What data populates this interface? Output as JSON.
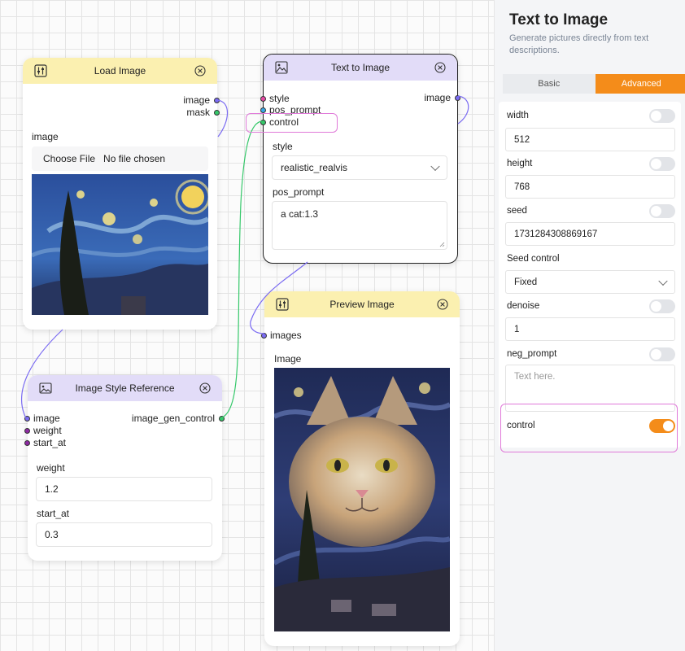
{
  "sidebar": {
    "title": "Text to Image",
    "subtitle": "Generate pictures directly from text descriptions.",
    "tabs": [
      {
        "label": "Basic"
      },
      {
        "label": "Advanced"
      }
    ],
    "fields": {
      "width": {
        "label": "width",
        "value": "512",
        "toggle": false
      },
      "height": {
        "label": "height",
        "value": "768",
        "toggle": false
      },
      "seed": {
        "label": "seed",
        "value": "1731284308869167",
        "toggle": false
      },
      "seed_control": {
        "label": "Seed control",
        "value": "Fixed"
      },
      "denoise": {
        "label": "denoise",
        "value": "1",
        "toggle": false
      },
      "neg_prompt": {
        "label": "neg_prompt",
        "placeholder": "Text here.",
        "toggle": false
      },
      "control": {
        "label": "control",
        "toggle": true
      }
    }
  },
  "nodes": {
    "load_image": {
      "title": "Load Image",
      "outputs": [
        "image",
        "mask"
      ],
      "field_label": "image",
      "file_button": "Choose File",
      "file_status": "No file chosen"
    },
    "text_to_image": {
      "title": "Text to Image",
      "inputs": [
        "style",
        "pos_prompt",
        "control"
      ],
      "outputs": [
        "image"
      ],
      "style_label": "style",
      "style_value": "realistic_realvis",
      "prompt_label": "pos_prompt",
      "prompt_value": "a cat:1.3"
    },
    "preview_image": {
      "title": "Preview Image",
      "inputs": [
        "images"
      ],
      "field_label": "Image"
    },
    "style_reference": {
      "title": "Image Style Reference",
      "inputs": [
        "image",
        "weight",
        "start_at"
      ],
      "outputs": [
        "image_gen_control"
      ],
      "weight_label": "weight",
      "weight_value": "1.2",
      "start_label": "start_at",
      "start_value": "0.3"
    }
  },
  "colors": {
    "accent": "#f48c1a",
    "yellow_header": "#fbf0b0",
    "purple_header": "#e2dcf8",
    "highlight": "#e07ad9",
    "wire_purple": "#7b6cf2",
    "wire_green": "#35c86a"
  },
  "icons": [
    "sliders-icon",
    "image-icon",
    "close-icon",
    "chevron-down-icon",
    "image-style-icon"
  ]
}
